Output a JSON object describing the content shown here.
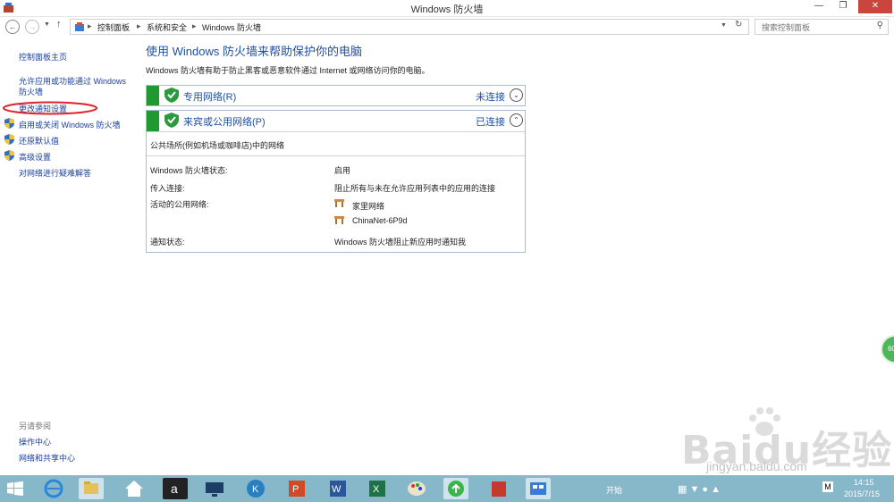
{
  "window": {
    "title": "Windows 防火墙"
  },
  "address": {
    "crumbs": [
      "控制面板",
      "系统和安全",
      "Windows 防火墙"
    ],
    "search_placeholder": "搜索控制面板"
  },
  "left_panel": {
    "links": [
      "控制面板主页",
      "允许应用或功能通过 Windows",
      "防火墙",
      "更改通知设置",
      "启用或关闭 Windows 防火墙",
      "还原默认值",
      "高级设置",
      "对网络进行疑难解答"
    ],
    "see_also_label": "另请参阅",
    "see_also": [
      "操作中心",
      "网络和共享中心"
    ]
  },
  "main": {
    "title": "使用 Windows 防火墙来帮助保护你的电脑",
    "description": "Windows 防火墙有助于防止黑客或恶意软件通过 Internet 或网络访问你的电脑。",
    "private_network": {
      "name": "专用网络(R)",
      "status": "未连接"
    },
    "public_network": {
      "name": "来宾或公用网络(P)",
      "status": "已连接",
      "description": "公共场所(例如机场或咖啡店)中的网络",
      "rows": [
        {
          "label": "Windows 防火墙状态:",
          "value": "启用"
        },
        {
          "label": "传入连接:",
          "value": "阻止所有与未在允许应用列表中的应用的连接"
        },
        {
          "label": "活动的公用网络:",
          "value": "家里网络"
        },
        {
          "label": "",
          "value": "ChinaNet-6P9d"
        },
        {
          "label": "通知状态:",
          "value": "Windows 防火墙阻止新应用时通知我"
        }
      ]
    }
  },
  "taskbar": {
    "time": "14:15",
    "date": "2015/7/15",
    "overlay_text": "开始"
  },
  "watermark": {
    "logo": "Baidu经验",
    "url": "jingyan.baidu.com"
  },
  "badge": "60"
}
